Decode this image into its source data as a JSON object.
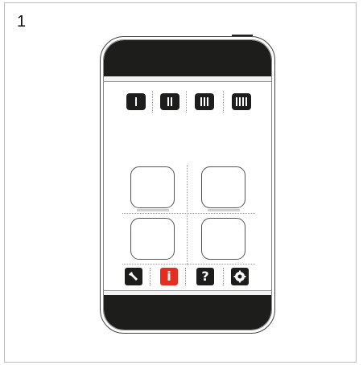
{
  "step": {
    "number": "1"
  },
  "mode_buttons": [
    {
      "name": "mode-1-button",
      "bars": 1
    },
    {
      "name": "mode-2-button",
      "bars": 2
    },
    {
      "name": "mode-3-button",
      "bars": 3
    },
    {
      "name": "mode-4-button",
      "bars": 4
    }
  ],
  "bottom_toolbar": {
    "tools": {
      "icon": "wrench-icon"
    },
    "info": {
      "glyph": "i",
      "icon": "info-icon",
      "accent": "#e52d20"
    },
    "help": {
      "glyph": "?",
      "icon": "question-icon"
    },
    "settings": {
      "icon": "gear-icon"
    }
  },
  "colors": {
    "bezel": "#1d1d1b",
    "accent": "#e52d20"
  }
}
